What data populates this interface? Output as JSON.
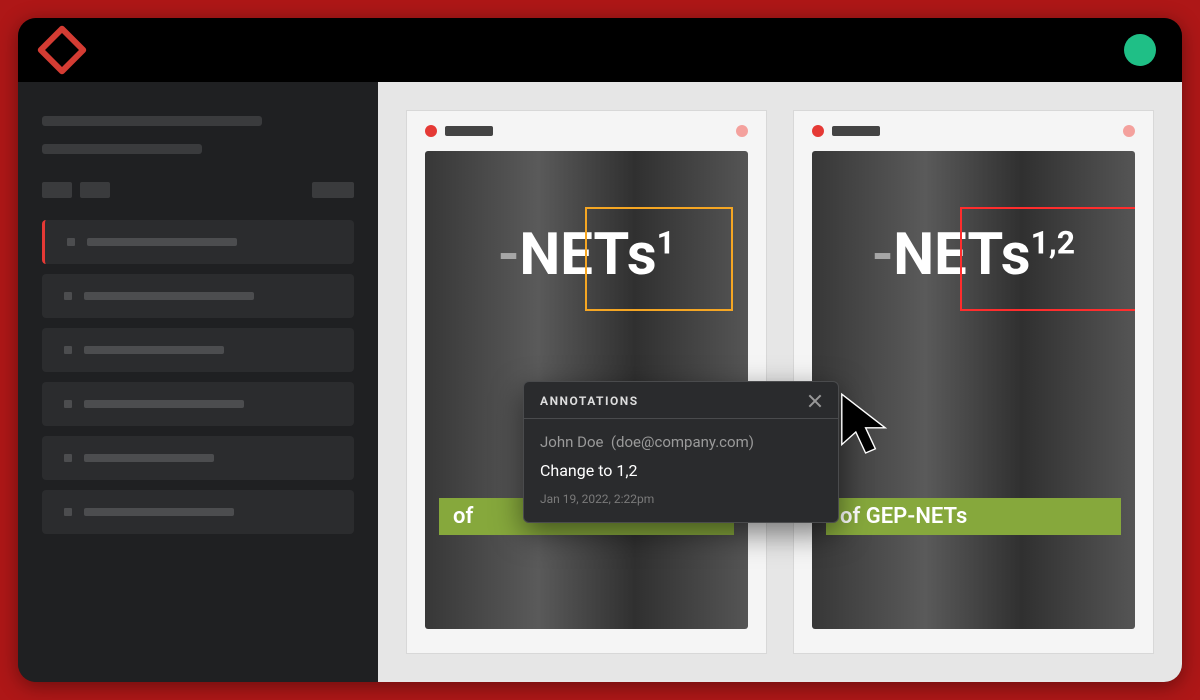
{
  "colors": {
    "accent_red": "#e53935",
    "avatar_green": "#1fbf86",
    "highlight_orange": "#f5a623",
    "highlight_red": "#ff2d2d",
    "caption_green": "#86a83c"
  },
  "pages": {
    "left": {
      "main_text_prefix": "-",
      "main_text": "NETs",
      "superscript": "1",
      "caption": "of",
      "highlight_color": "orange"
    },
    "right": {
      "main_text_prefix": "-",
      "main_text": "NETs",
      "superscript": "1,2",
      "caption": "of GEP-NETs",
      "highlight_color": "red"
    }
  },
  "popover": {
    "title": "ANNOTATIONS",
    "author_name": "John Doe",
    "author_email": "(doe@company.com)",
    "message": "Change to 1,2",
    "timestamp": "Jan 19, 2022, 2:22pm"
  }
}
